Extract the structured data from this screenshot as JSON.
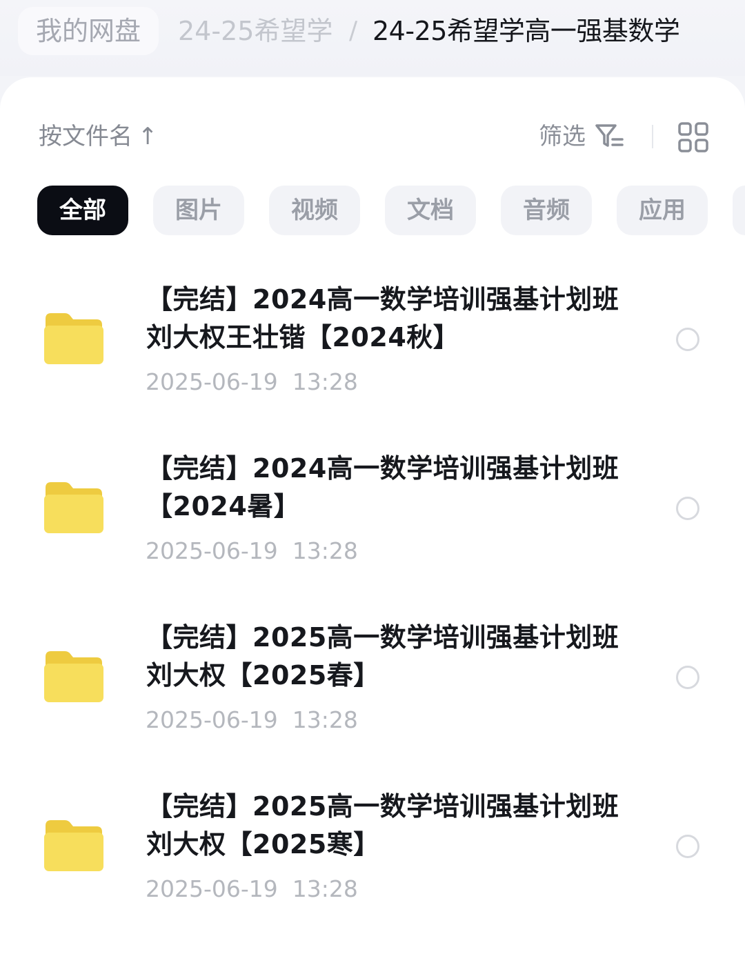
{
  "breadcrumb": {
    "root": "我的网盘",
    "parent": "24-25希望学",
    "separator": "/",
    "current": "24-25希望学高一强基数学"
  },
  "toolbar": {
    "sort_label": "按文件名",
    "sort_arrow": "↑",
    "filter_label": "筛选",
    "filter_icon": "filter-icon",
    "view_icon": "grid-view-icon"
  },
  "categories": [
    {
      "label": "全部",
      "active": true
    },
    {
      "label": "图片",
      "active": false
    },
    {
      "label": "视频",
      "active": false
    },
    {
      "label": "文档",
      "active": false
    },
    {
      "label": "音频",
      "active": false
    },
    {
      "label": "应用",
      "active": false
    }
  ],
  "files": [
    {
      "name": "【完结】2024高一数学培训强基计划班刘大权王壮锴【2024秋】",
      "date": "2025-06-19  13:28",
      "icon": "folder-icon"
    },
    {
      "name": "【完结】2024高一数学培训强基计划班【2024暑】",
      "date": "2025-06-19  13:28",
      "icon": "folder-icon"
    },
    {
      "name": "【完结】2025高一数学培训强基计划班刘大权【2025春】",
      "date": "2025-06-19  13:28",
      "icon": "folder-icon"
    },
    {
      "name": "【完结】2025高一数学培训强基计划班刘大权【2025寒】",
      "date": "2025-06-19  13:28",
      "icon": "folder-icon"
    }
  ],
  "colors": {
    "folder": "#f5dc5a",
    "active_chip": "#0b0d14",
    "chip_bg": "#f2f3f7",
    "date_text": "#b4b7bd"
  }
}
